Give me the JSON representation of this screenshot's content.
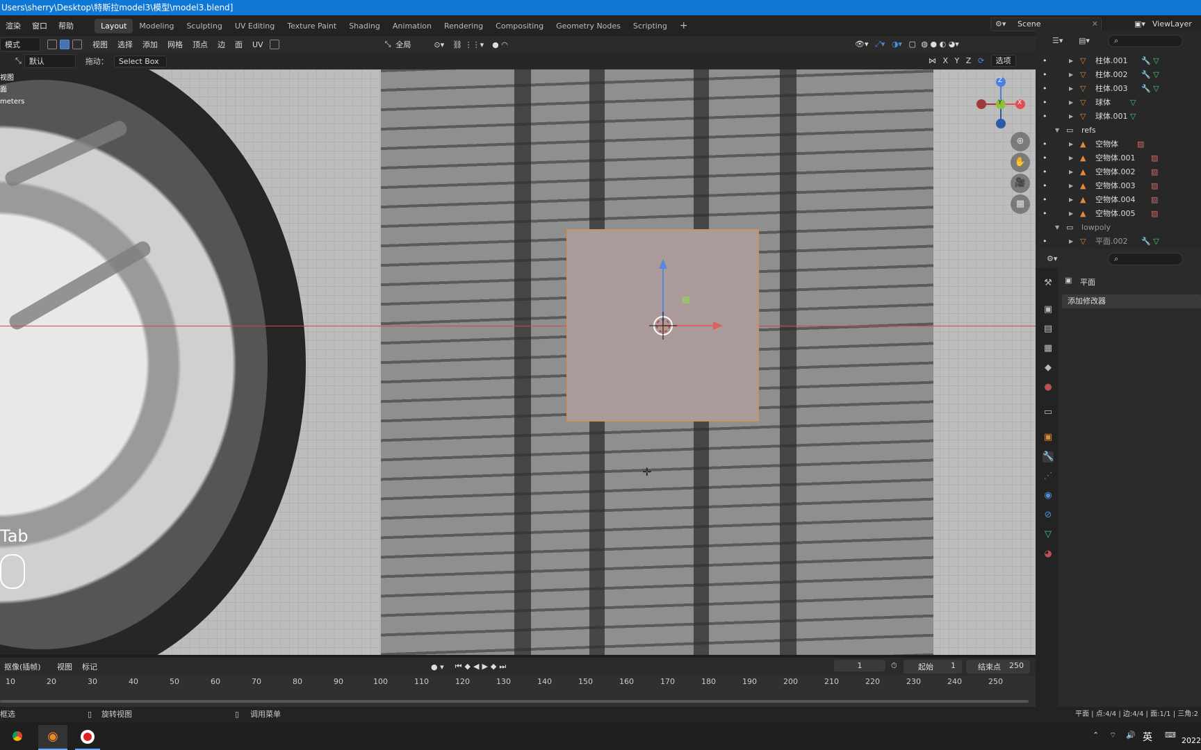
{
  "window": {
    "title": "Users\\sherry\\Desktop\\特斯拉model3\\模型\\model3.blend]"
  },
  "menus": [
    "渲染",
    "窗口",
    "帮助"
  ],
  "workspaces": [
    "Layout",
    "Modeling",
    "Sculpting",
    "UV Editing",
    "Texture Paint",
    "Shading",
    "Animation",
    "Rendering",
    "Compositing",
    "Geometry Nodes",
    "Scripting"
  ],
  "active_workspace": "Layout",
  "scene": {
    "name": "Scene",
    "view_layer": "ViewLayer"
  },
  "viewport_header": {
    "mode": "模式",
    "menus": [
      "视图",
      "选择",
      "添加",
      "网格",
      "顶点",
      "边",
      "面",
      "UV"
    ],
    "transform_orientation": "全局"
  },
  "tool_header": {
    "orientation": "默认",
    "drag_label": "拖动：",
    "drag_value": "Select Box",
    "axes": [
      "X",
      "Y",
      "Z"
    ],
    "options": "选项"
  },
  "viewport_overlay": {
    "lines": [
      "视图",
      "面",
      "meters"
    ],
    "key_hint": "Tab"
  },
  "gizmo": {
    "z": "Z",
    "y": "Y",
    "x": "X"
  },
  "outliner": {
    "items": [
      {
        "name": "柱体.001",
        "type": "mesh",
        "indent": 2
      },
      {
        "name": "柱体.002",
        "type": "mesh",
        "indent": 2
      },
      {
        "name": "柱体.003",
        "type": "mesh",
        "indent": 2
      },
      {
        "name": "球体",
        "type": "mesh",
        "indent": 2
      },
      {
        "name": "球体.001",
        "type": "mesh",
        "indent": 2
      },
      {
        "name": "refs",
        "type": "collection",
        "indent": 1
      },
      {
        "name": "空物体",
        "type": "empty",
        "indent": 2
      },
      {
        "name": "空物体.001",
        "type": "empty",
        "indent": 2
      },
      {
        "name": "空物体.002",
        "type": "empty",
        "indent": 2
      },
      {
        "name": "空物体.003",
        "type": "empty",
        "indent": 2
      },
      {
        "name": "空物体.004",
        "type": "empty",
        "indent": 2
      },
      {
        "name": "空物体.005",
        "type": "empty",
        "indent": 2
      },
      {
        "name": "lowpoly",
        "type": "collection",
        "indent": 1
      },
      {
        "name": "平面.002",
        "type": "mesh",
        "indent": 2
      }
    ]
  },
  "properties": {
    "object_name": "平面",
    "add_modifier": "添加修改器"
  },
  "timeline": {
    "mode": "抠像(插帧)",
    "menus": [
      "视图",
      "标记"
    ],
    "current_frame": "1",
    "start_label": "起始",
    "start": "1",
    "end_label": "结束点",
    "end": "250",
    "ticks": [
      "10",
      "20",
      "30",
      "40",
      "50",
      "60",
      "70",
      "80",
      "90",
      "100",
      "110",
      "120",
      "130",
      "140",
      "150",
      "160",
      "170",
      "180",
      "190",
      "200",
      "210",
      "220",
      "230",
      "240",
      "250"
    ]
  },
  "statusbar": {
    "left": "框选",
    "middle": "旋转视图",
    "right": "调用菜单",
    "stats": "平面 | 点:4/4 | 边:4/4 | 面:1/1 | 三角:2"
  },
  "taskbar": {
    "ime": "英",
    "clock": "2022"
  }
}
